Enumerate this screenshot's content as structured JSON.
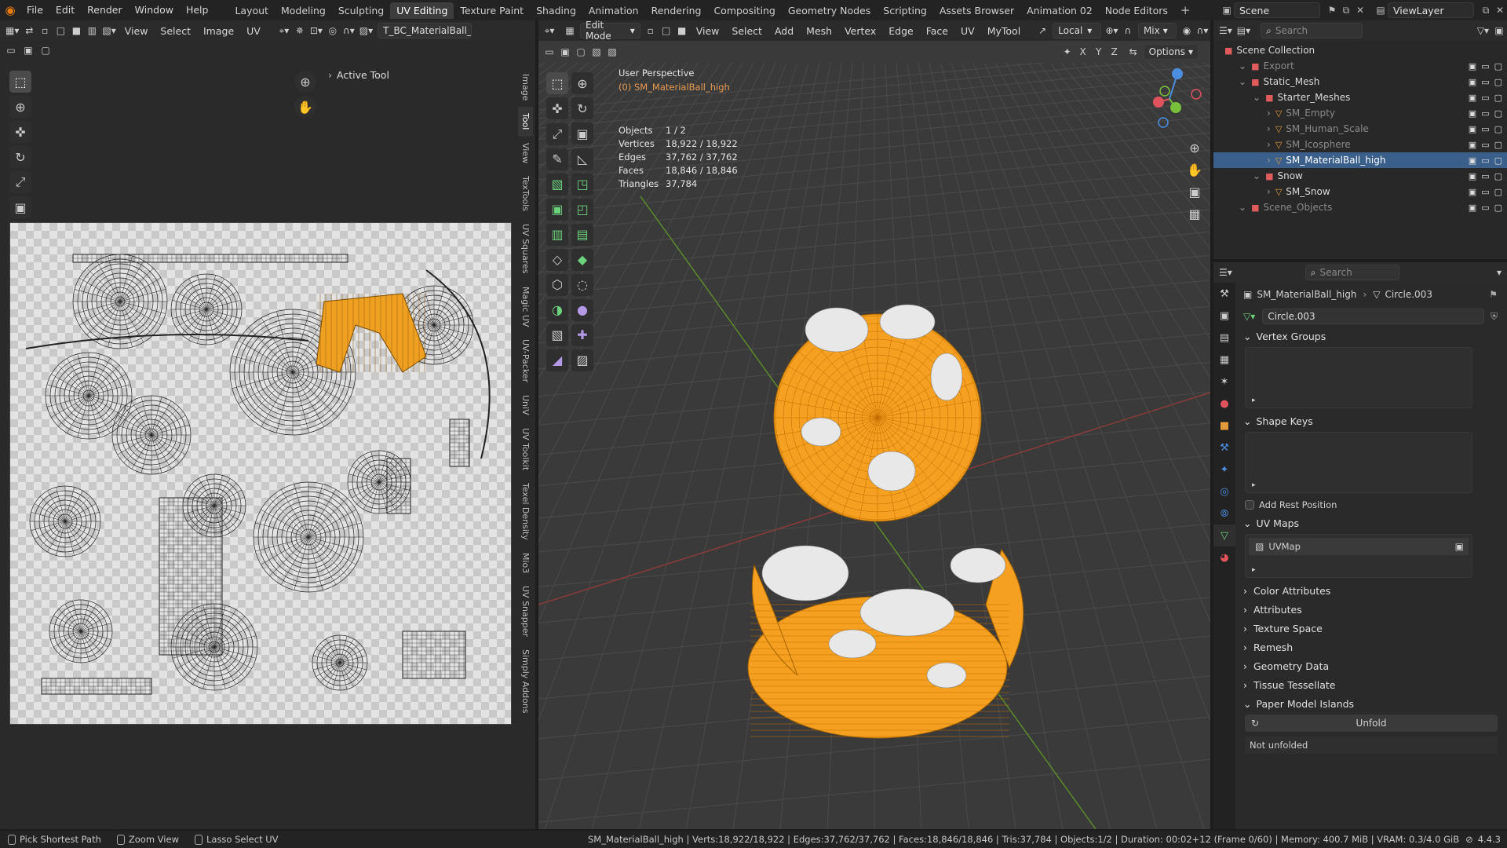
{
  "topbar": {
    "menus": [
      "File",
      "Edit",
      "Render",
      "Window",
      "Help"
    ],
    "workspaces": [
      "Layout",
      "Modeling",
      "Sculpting",
      "UV Editing",
      "Texture Paint",
      "Shading",
      "Animation",
      "Rendering",
      "Compositing",
      "Geometry Nodes",
      "Scripting",
      "Assets Browser",
      "Animation 02",
      "Node Editors"
    ],
    "active_workspace": "UV Editing",
    "scene": "Scene",
    "view_layer": "ViewLayer"
  },
  "uv_editor": {
    "menus": [
      "View",
      "Select",
      "Image",
      "UV"
    ],
    "image_name": "T_BC_MaterialBall_Pai",
    "npanel_title": "Active Tool",
    "side_tabs": [
      "Image",
      "Tool",
      "View",
      "TexTools",
      "UV Squares",
      "Magic UV",
      "UV-Packer",
      "UniV",
      "UV Toolkit",
      "Texel Density",
      "Mio3",
      "UV Snapper",
      "Simply Addons"
    ],
    "active_side_tab": "Tool"
  },
  "viewport": {
    "mode": "Edit Mode",
    "menus": [
      "View",
      "Select",
      "Add",
      "Mesh",
      "Vertex",
      "Edge",
      "Face",
      "UV",
      "MyTool"
    ],
    "orientation": "Local",
    "snap": "Mix",
    "options_label": "Options",
    "axes": [
      "X",
      "Y",
      "Z"
    ],
    "perspective": "User Perspective",
    "object_label": "(0) SM_MaterialBall_high",
    "stats": [
      {
        "k": "Objects",
        "v": "1 / 2"
      },
      {
        "k": "Vertices",
        "v": "18,922 / 18,922"
      },
      {
        "k": "Edges",
        "v": "37,762 / 37,762"
      },
      {
        "k": "Faces",
        "v": "18,846 / 18,846"
      },
      {
        "k": "Triangles",
        "v": "37,784"
      }
    ],
    "colors": {
      "mesh": "#f5a020",
      "background": "#3a3a3a",
      "grid": "#4a4a4a"
    }
  },
  "outliner": {
    "search_placeholder": "Search",
    "rows": [
      {
        "label": "Scene Collection",
        "indent": 0,
        "type": "scene"
      },
      {
        "label": "Export",
        "indent": 1,
        "type": "coll",
        "dim": true
      },
      {
        "label": "Static_Mesh",
        "indent": 1,
        "type": "coll"
      },
      {
        "label": "Starter_Meshes",
        "indent": 2,
        "type": "coll"
      },
      {
        "label": "SM_Empty",
        "indent": 3,
        "type": "mesh",
        "dim": true
      },
      {
        "label": "SM_Human_Scale",
        "indent": 3,
        "type": "mesh",
        "dim": true
      },
      {
        "label": "SM_Icosphere",
        "indent": 3,
        "type": "mesh",
        "dim": true
      },
      {
        "label": "SM_MaterialBall_high",
        "indent": 3,
        "type": "mesh",
        "selected": true
      },
      {
        "label": "Snow",
        "indent": 2,
        "type": "coll"
      },
      {
        "label": "SM_Snow",
        "indent": 3,
        "type": "mesh"
      },
      {
        "label": "Scene_Objects",
        "indent": 1,
        "type": "coll",
        "dim": true
      }
    ]
  },
  "properties": {
    "search_placeholder": "Search",
    "breadcrumb_object": "SM_MaterialBall_high",
    "breadcrumb_data": "Circle.003",
    "data_name": "Circle.003",
    "panels": {
      "vertex_groups": "Vertex Groups",
      "shape_keys": "Shape Keys",
      "add_rest_position": "Add Rest Position",
      "uv_maps": "UV Maps",
      "uv_map_item": "UVMap",
      "collapsed": [
        "Color Attributes",
        "Attributes",
        "Texture Space",
        "Remesh",
        "Geometry Data",
        "Tissue Tessellate"
      ],
      "paper_model": "Paper Model Islands",
      "unfold_button": "Unfold",
      "not_unfolded": "Not unfolded"
    }
  },
  "statusbar": {
    "left": [
      "Pick Shortest Path",
      "Zoom View",
      "Lasso Select UV"
    ],
    "right": "SM_MaterialBall_high | Verts:18,922/18,922 | Edges:37,762/37,762 | Faces:18,846/18,846 | Tris:37,784 | Objects:1/2 | Duration: 00:02+12 (Frame 0/60) | Memory: 400.7 MiB | VRAM: 0.3/4.0 GiB",
    "version": "4.4.3"
  }
}
